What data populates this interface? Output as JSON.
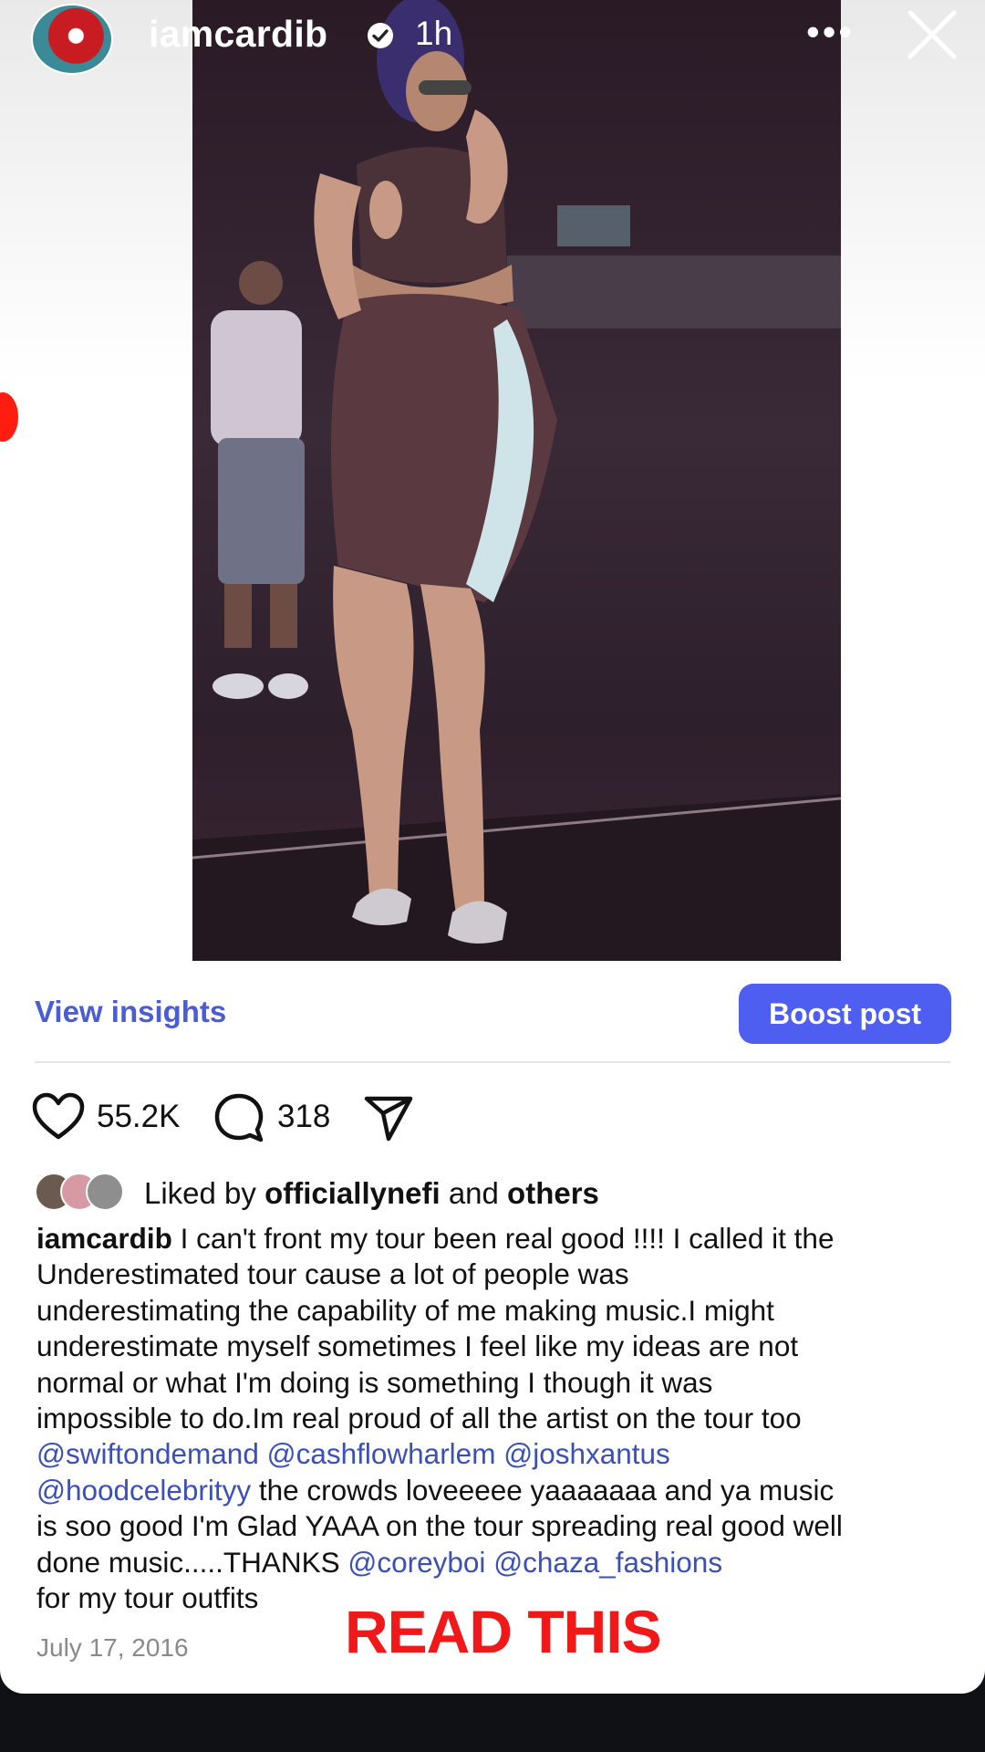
{
  "story": {
    "username": "iamcardib",
    "time": "1h"
  },
  "post": {
    "view_insights": "View insights",
    "boost_post": "Boost post",
    "likes_count": "55.2K",
    "comments_count": "318",
    "liked_by_prefix": "Liked by",
    "liked_by_user": "officiallynefi",
    "liked_by_and": "and",
    "liked_by_others": "others",
    "caption": {
      "author": "iamcardib",
      "l1": " I can't front my tour been real good !!!! I called it the",
      "l2": "Underestimated tour cause a lot of people was",
      "l3": "underestimating the capability of me making music.I might",
      "l4": "underestimate myself sometimes I feel like my ideas are not",
      "l5": "normal or what I'm doing is something I though it was",
      "l6": "impossible to do.Im real proud of all the artist on the tour too",
      "m1": "@swiftondemand",
      "m2": "@cashflowharlem",
      "m3": "@joshxantus",
      "m4": "@hoodcelebrityy",
      "l8": " the crowds loveeeee yaaaaaaa and ya music",
      "l9": "is soo good I'm Glad YAAA on the tour spreading real good well",
      "l10": "done music.....THANKS ",
      "m5": "@coreyboi",
      "m6": "@chaza_fashions",
      "l11": "for my tour outfits"
    },
    "date": "July 17, 2016"
  },
  "overlay_text": "READ THIS",
  "colors": {
    "accent_blue": "#4d5ef0",
    "mention_blue": "#3b4fb8",
    "overlay_red": "#f01818"
  }
}
